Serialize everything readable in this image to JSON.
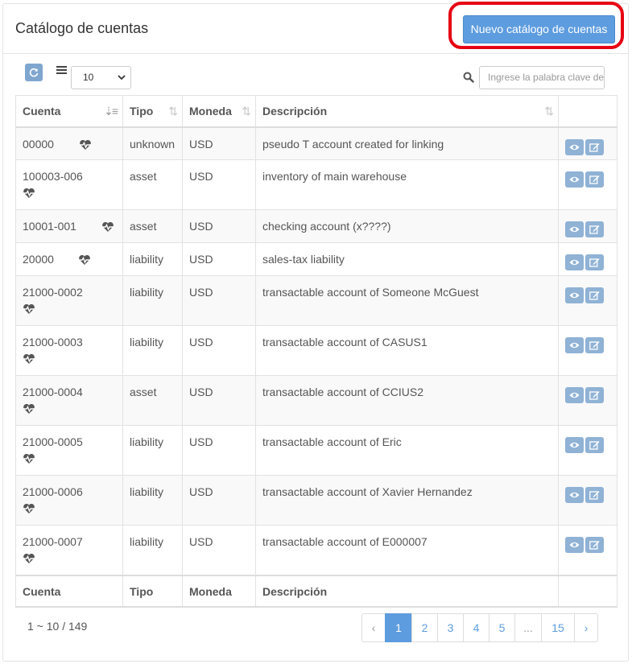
{
  "header": {
    "title": "Catálogo de cuentas",
    "new_button_label": "Nuevo catálogo de cuentas"
  },
  "toolbar": {
    "refresh_icon": "refresh-icon",
    "list_icon": "list-icon",
    "page_size": "10",
    "search_placeholder": "Ingrese la palabra clave de búsqueda"
  },
  "table": {
    "columns": [
      "Cuenta",
      "Tipo",
      "Moneda",
      "Descripción"
    ],
    "rows": [
      {
        "cuenta": "00000",
        "tipo": "unknown",
        "moneda": "USD",
        "descripcion": "pseudo T account created for linking"
      },
      {
        "cuenta": "100003-006",
        "tipo": "asset",
        "moneda": "USD",
        "descripcion": "inventory of main warehouse"
      },
      {
        "cuenta": "10001-001",
        "tipo": "asset",
        "moneda": "USD",
        "descripcion": "checking account (x????)"
      },
      {
        "cuenta": "20000",
        "tipo": "liability",
        "moneda": "USD",
        "descripcion": "sales-tax liability"
      },
      {
        "cuenta": "21000-0002",
        "tipo": "liability",
        "moneda": "USD",
        "descripcion": "transactable account of Someone McGuest"
      },
      {
        "cuenta": "21000-0003",
        "tipo": "liability",
        "moneda": "USD",
        "descripcion": "transactable account of CASUS1"
      },
      {
        "cuenta": "21000-0004",
        "tipo": "asset",
        "moneda": "USD",
        "descripcion": "transactable account of CCIUS2"
      },
      {
        "cuenta": "21000-0005",
        "tipo": "liability",
        "moneda": "USD",
        "descripcion": "transactable account of Eric"
      },
      {
        "cuenta": "21000-0006",
        "tipo": "liability",
        "moneda": "USD",
        "descripcion": "transactable account of Xavier Hernandez"
      },
      {
        "cuenta": "21000-0007",
        "tipo": "liability",
        "moneda": "USD",
        "descripcion": "transactable account of E000007"
      }
    ]
  },
  "footer": {
    "range": "1 ~ 10 / 149",
    "pagination": [
      "‹",
      "1",
      "2",
      "3",
      "4",
      "5",
      "...",
      "15",
      "›"
    ],
    "current_page": "1"
  },
  "colors": {
    "primary": "#5d9cde",
    "action_button": "#8fb2d5",
    "highlight": "#e60012"
  }
}
